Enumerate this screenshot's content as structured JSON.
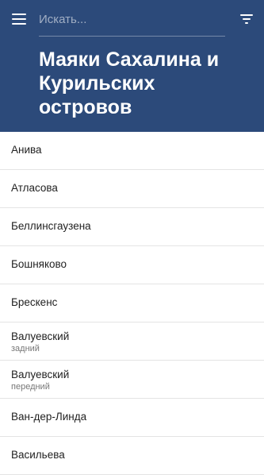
{
  "header": {
    "search_placeholder": "Искать...",
    "title": "Маяки Сахалина и Курильских островов",
    "menu_icon": "hamburger-menu-icon",
    "filter_icon": "filter-icon",
    "background_color": "#2c4a7a"
  },
  "lighthouses": [
    {
      "name": "Анива",
      "subtitle": ""
    },
    {
      "name": "Атласова",
      "subtitle": ""
    },
    {
      "name": "Беллинсгаузена",
      "subtitle": ""
    },
    {
      "name": "Бошняково",
      "subtitle": ""
    },
    {
      "name": "Брескенс",
      "subtitle": ""
    },
    {
      "name": "Валуевский",
      "subtitle": "задний"
    },
    {
      "name": "Валуевский",
      "subtitle": "передний"
    },
    {
      "name": "Ван-дер-Линда",
      "subtitle": ""
    },
    {
      "name": "Васильева",
      "subtitle": ""
    }
  ]
}
